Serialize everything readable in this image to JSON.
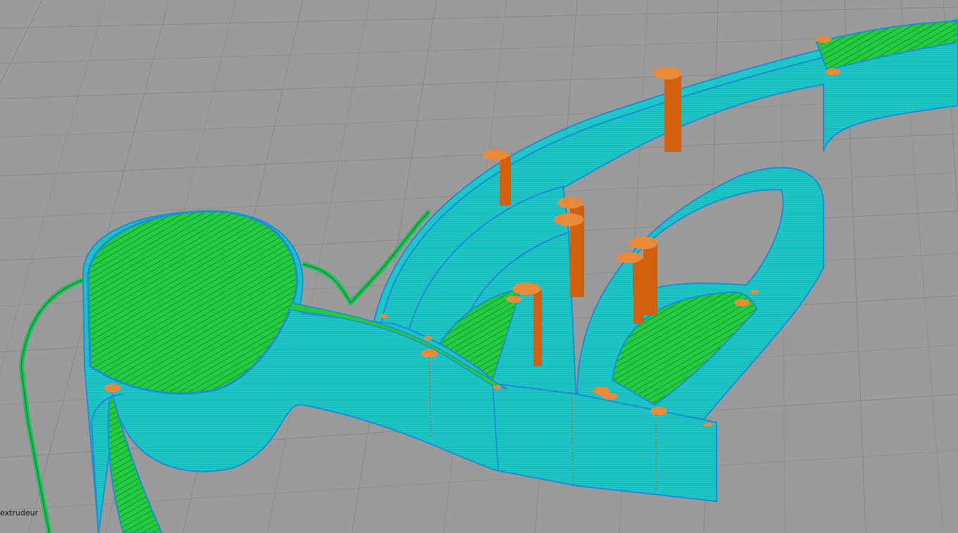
{
  "viewer": {
    "legend_label": "extrudeur",
    "colors": {
      "background": "#9a9a9a",
      "grid_line": "#8a8a8a",
      "grid_line_major": "#7a7a7a",
      "wall": "#1ec7c7",
      "wall_edge": "#1a8fd6",
      "infill": "#23c93f",
      "infill_dark": "#129a2a",
      "travel_skirt": "#1fbf5a",
      "retraction": "#d2600e",
      "retraction_top": "#e98a3a"
    }
  }
}
